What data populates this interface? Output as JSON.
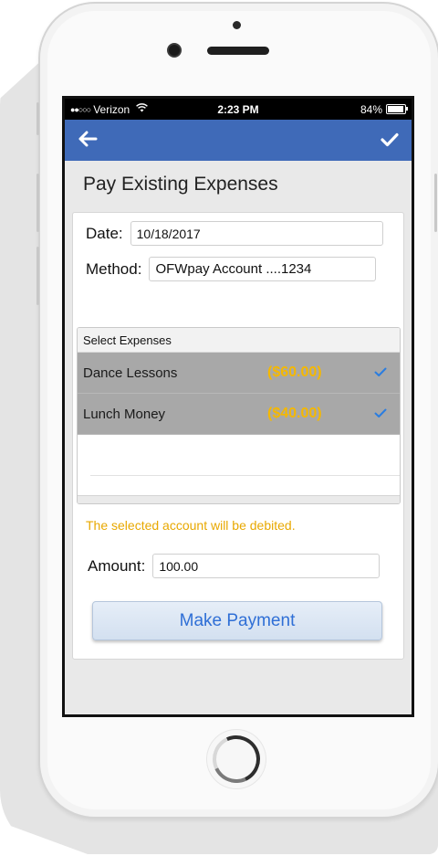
{
  "status_bar": {
    "signal": "●●○○○",
    "carrier": "Verizon",
    "time": "2:23 PM",
    "battery": "84%"
  },
  "nav": {
    "back_icon": "back-arrow-icon",
    "confirm_icon": "checkmark-icon",
    "back_glyph": "🡐",
    "confirm_glyph": "✔"
  },
  "page": {
    "title": "Pay Existing Expenses"
  },
  "form": {
    "date_label": "Date:",
    "date_value": "10/18/2017",
    "method_label": "Method:",
    "method_value": "OFWpay Account ....1234",
    "expenses_header": "Select Expenses",
    "expenses": [
      {
        "name": "Dance Lessons",
        "amount": "($60.00)",
        "checked": true
      },
      {
        "name": "Lunch Money",
        "amount": "($40.00)",
        "checked": true
      }
    ],
    "notice": "The selected account will be debited.",
    "amount_label": "Amount:",
    "amount_value": "100.00",
    "submit_label": "Make Payment"
  },
  "colors": {
    "nav_bar": "#3f6ab8",
    "amount_text": "#f5b800",
    "notice_text": "#e8a800",
    "check": "#2a7de0",
    "button_text": "#2f6fd6"
  }
}
